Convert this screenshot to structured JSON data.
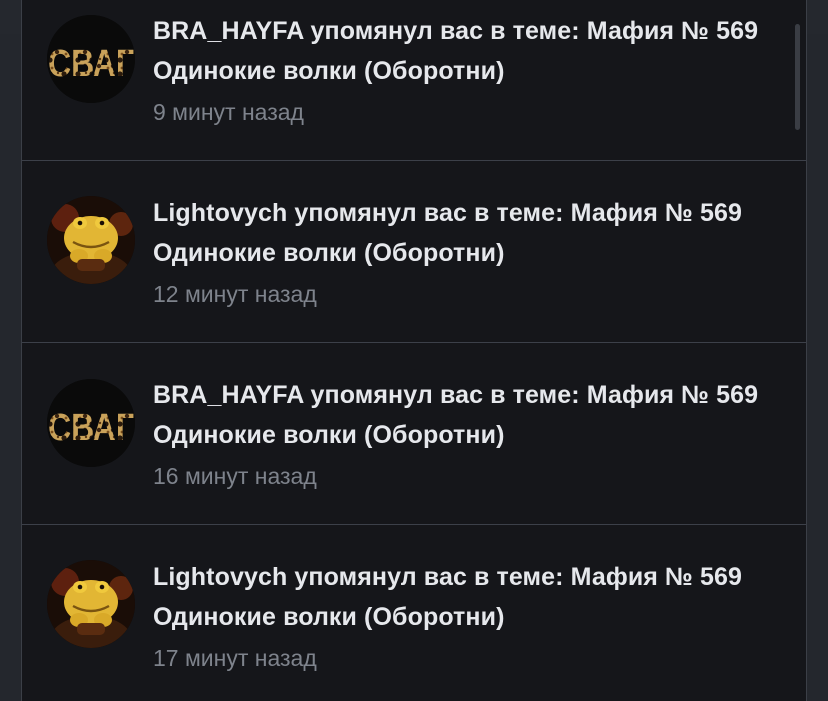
{
  "notifications": [
    {
      "text": "BRA_HAYFA упомянул вас в теме: Мафия № 569 Одинокие волки (Оборотни)",
      "time": "9 минут назад",
      "avatar": "svag-avatar",
      "avatar_text": "СВАГ"
    },
    {
      "text": "Lightovych упомянул вас в теме: Мафия № 569 Одинокие волки (Оборотни)",
      "time": "12 минут назад",
      "avatar": "toad-avatar"
    },
    {
      "text": "BRA_HAYFA упомянул вас в теме: Мафия № 569 Одинокие волки (Оборотни)",
      "time": "16 минут назад",
      "avatar": "svag-avatar",
      "avatar_text": "СВАГ"
    },
    {
      "text": "Lightovych упомянул вас в теме: Мафия № 569 Одинокие волки (Оборотни)",
      "time": "17 минут назад",
      "avatar": "toad-avatar"
    }
  ],
  "colors": {
    "background": "#15161a",
    "title": "#e6e8ec",
    "time": "#7e838c",
    "divider": "#3c4049",
    "leopard": "#c9a25a"
  }
}
